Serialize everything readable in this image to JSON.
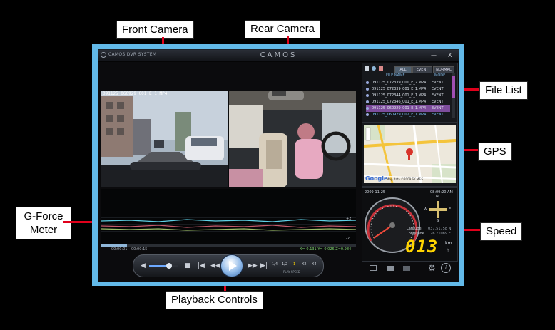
{
  "callouts": {
    "front_camera": "Front Camera",
    "rear_camera": "Rear Camera",
    "file_list": "File List",
    "gps": "GPS",
    "gforce_line1": "G-Force",
    "gforce_line2": "Meter",
    "speed": "Speed",
    "playback": "Playback Controls"
  },
  "window": {
    "brand": "CAMOS DVR SYSTEM",
    "title": "CAMOS",
    "minimize": "—",
    "close": "X"
  },
  "front_video": {
    "overlay_text": "091125_060929_001_E_1.MP4"
  },
  "file_list": {
    "tabs": [
      "ALL",
      "EVENT",
      "NORMAL"
    ],
    "columns": [
      "FILE NAME",
      "MODE"
    ],
    "rows": [
      {
        "name": "091125_072339_000_E_2.MP4",
        "mode": "EVENT"
      },
      {
        "name": "091125_072339_001_E_1.MP4",
        "mode": "EVENT"
      },
      {
        "name": "091125_072344_001_E_1.MP4",
        "mode": "EVENT"
      },
      {
        "name": "091125_072346_001_E_1.MP4",
        "mode": "EVENT"
      },
      {
        "name": "091125_060929_001_E_1.MP4",
        "mode": "EVENT"
      },
      {
        "name": "091125_060929_002_E_1.MP4",
        "mode": "EVENT"
      }
    ]
  },
  "map": {
    "provider": "Google",
    "attribution": "Map data ©2009 SK M&S"
  },
  "gforce": {
    "time_start": "00:00:01",
    "time_end": "00:00:15",
    "scale_top": "+2",
    "scale_bottom": "-2",
    "readout": "X=-0.131  Y=-0.026  Z=0.984"
  },
  "speed_panel": {
    "date": "2009-11-25",
    "time": "08:09:20 AM",
    "latitude_label": "Latitude",
    "latitude_value": "037.51758 N",
    "longitude_label": "Longitude",
    "longitude_value": "126.71089 E",
    "speed_value": "013",
    "unit_top": "km",
    "unit_bottom": "h",
    "compass_n": "N",
    "compass_s": "S",
    "compass_e": "E",
    "compass_w": "W"
  },
  "playback": {
    "speed_options": [
      "1/4",
      "1/2",
      "1",
      "X2",
      "X4"
    ],
    "speed_label": "PLAY SPEED",
    "volume_level": 0.7,
    "progress": 0.1
  },
  "colors": {
    "frame": "#62b9e8",
    "callout_line": "#e0001b",
    "speed_digits": "#ffd400"
  }
}
